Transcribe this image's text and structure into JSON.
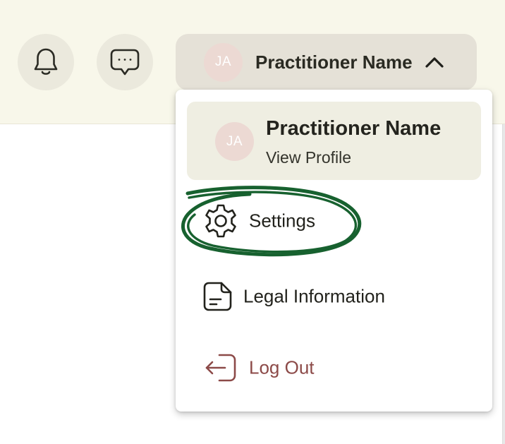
{
  "header": {
    "notifications_icon": "bell-icon",
    "messages_icon": "chat-bubble-dots-icon",
    "user_menu": {
      "avatar_initials": "JA",
      "name": "Practitioner Name",
      "chevron_icon": "chevron-up-icon"
    }
  },
  "dropdown": {
    "profile": {
      "avatar_initials": "JA",
      "name": "Practitioner Name",
      "link_label": "View Profile"
    },
    "items": [
      {
        "label": "Settings",
        "icon": "gear-icon"
      },
      {
        "label": "Legal Information",
        "icon": "document-icon"
      },
      {
        "label": "Log Out",
        "icon": "logout-icon"
      }
    ]
  },
  "colors": {
    "header_bg": "#f8f7ea",
    "icon_button_bg": "#ebe9dd",
    "user_pill_bg": "#e5e1d7",
    "avatar_bg": "#ecd9d3",
    "profile_card_bg": "#efeee2",
    "logout_color": "#8c4a48",
    "annotation_green": "#17612f"
  }
}
